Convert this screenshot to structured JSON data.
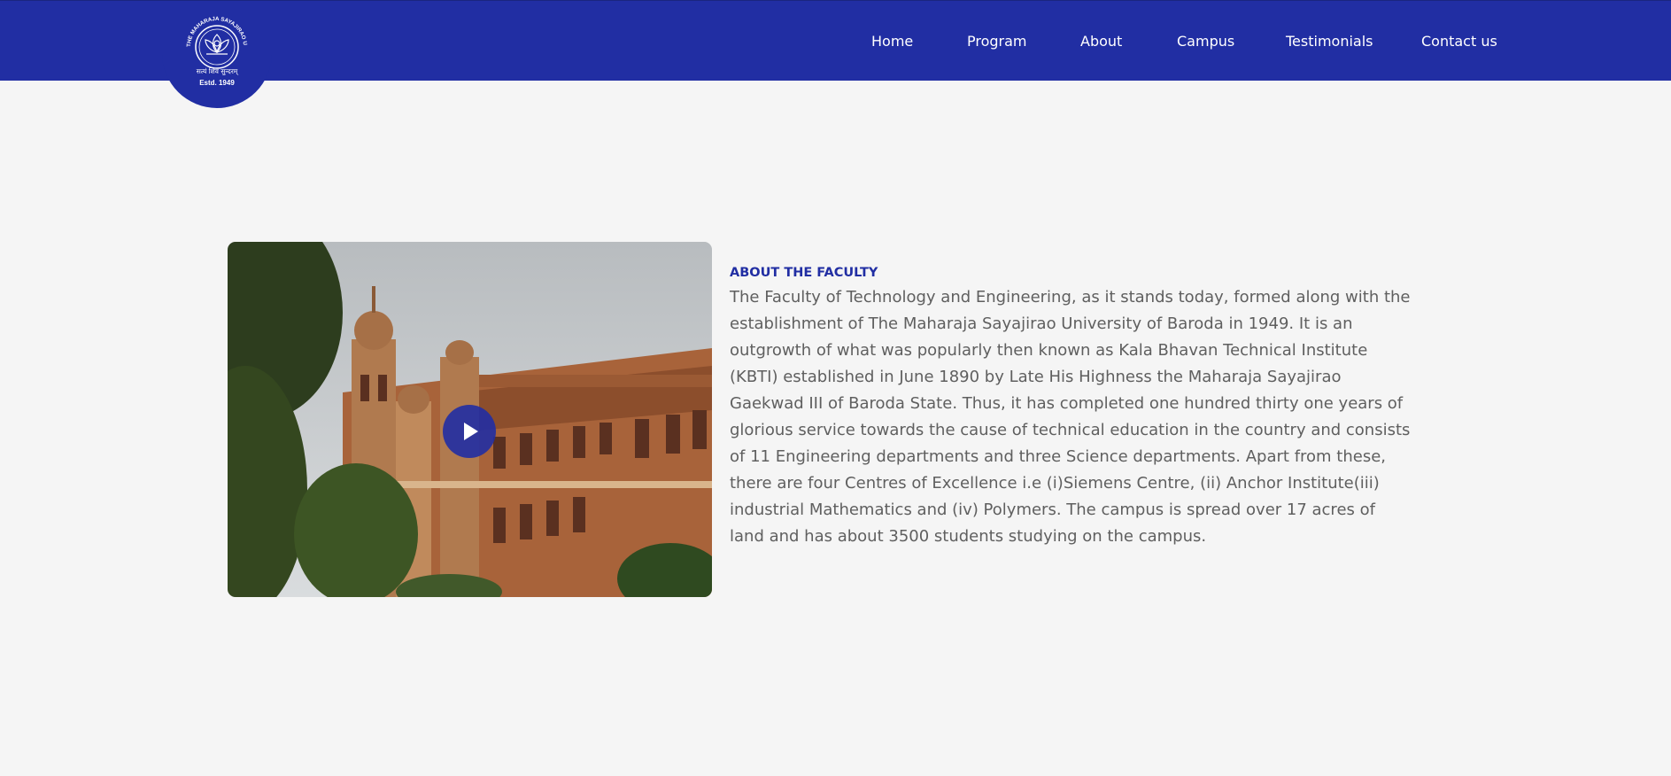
{
  "header": {
    "logo": {
      "arc_text": "THE MAHARAJA SAYAJIRAO UNIVERSITY OF BARODA",
      "motto": "सत्यं शिवं सुन्दरम्",
      "estd": "Estd. 1949"
    },
    "nav": [
      "Home",
      "Program",
      "About",
      "Campus",
      "Testimonials",
      "Contact us"
    ]
  },
  "about": {
    "kicker": "ABOUT THE FACULTY",
    "body": "The Faculty of Technology and Engineering, as it stands today, formed along with the establishment of The Maharaja Sayajirao University of Baroda in 1949. It is an outgrowth of what was popularly then known as Kala Bhavan Technical Institute (KBTI) established in June 1890 by Late His Highness the Maharaja Sayajirao Gaekwad III of Baroda State. Thus, it has completed one hundred thirty one years of glorious service towards the cause of technical education in the country and consists of 11 Engineering departments and three Science departments. Apart from these, there are four Centres of Excellence i.e (i)Siemens Centre, (ii) Anchor Institute(iii) industrial Mathematics and (iv) Polymers. The campus is spread over 17 acres of land and has about 3500 students studying on the campus."
  },
  "media": {
    "play_icon": "play-icon"
  },
  "colors": {
    "brand": "#212ea3",
    "page_bg": "#f5f5f5",
    "body_text": "#5f5f5f"
  }
}
